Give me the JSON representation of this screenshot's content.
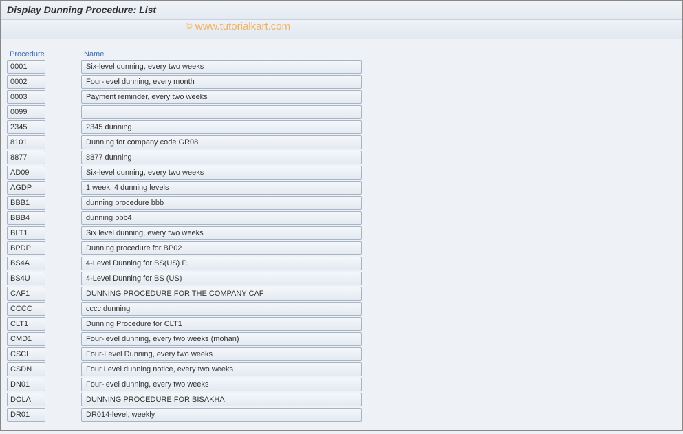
{
  "title": "Display Dunning Procedure: List",
  "watermark": "www.tutorialkart.com",
  "columns": {
    "procedure": "Procedure",
    "name": "Name"
  },
  "rows": [
    {
      "proc": "0001",
      "name": "Six-level dunning, every two weeks"
    },
    {
      "proc": "0002",
      "name": "Four-level dunning, every month"
    },
    {
      "proc": "0003",
      "name": "Payment reminder, every two weeks"
    },
    {
      "proc": "0099",
      "name": ""
    },
    {
      "proc": "2345",
      "name": " 2345 dunning"
    },
    {
      "proc": "8101",
      "name": "Dunning for company code GR08"
    },
    {
      "proc": "8877",
      "name": "8877 dunning"
    },
    {
      "proc": "AD09",
      "name": "Six-level dunning, every two weeks"
    },
    {
      "proc": "AGDP",
      "name": "1 week, 4 dunning levels"
    },
    {
      "proc": "BBB1",
      "name": "dunning procedure bbb"
    },
    {
      "proc": "BBB4",
      "name": "dunning bbb4"
    },
    {
      "proc": "BLT1",
      "name": "Six level dunning, every two weeks"
    },
    {
      "proc": "BPDP",
      "name": "Dunning procedure for BP02"
    },
    {
      "proc": "BS4A",
      "name": "4-Level Dunning for BS(US) P."
    },
    {
      "proc": "BS4U",
      "name": "4-Level Dunning for BS (US)"
    },
    {
      "proc": "CAF1",
      "name": "DUNNING PROCEDURE FOR THE COMPANY CAF"
    },
    {
      "proc": "CCCC",
      "name": "cccc dunning"
    },
    {
      "proc": "CLT1",
      "name": "Dunning Procedure for CLT1"
    },
    {
      "proc": "CMD1",
      "name": "Four-level dunning, every two weeks (mohan)"
    },
    {
      "proc": "CSCL",
      "name": "Four-Level Dunning, every two weeks"
    },
    {
      "proc": "CSDN",
      "name": "Four Level dunning notice, every two weeks"
    },
    {
      "proc": "DN01",
      "name": "Four-level dunning, every two weeks"
    },
    {
      "proc": "DOLA",
      "name": "DUNNING PROCEDURE FOR BISAKHA"
    },
    {
      "proc": "DR01",
      "name": "DR014-level; weekly"
    }
  ]
}
